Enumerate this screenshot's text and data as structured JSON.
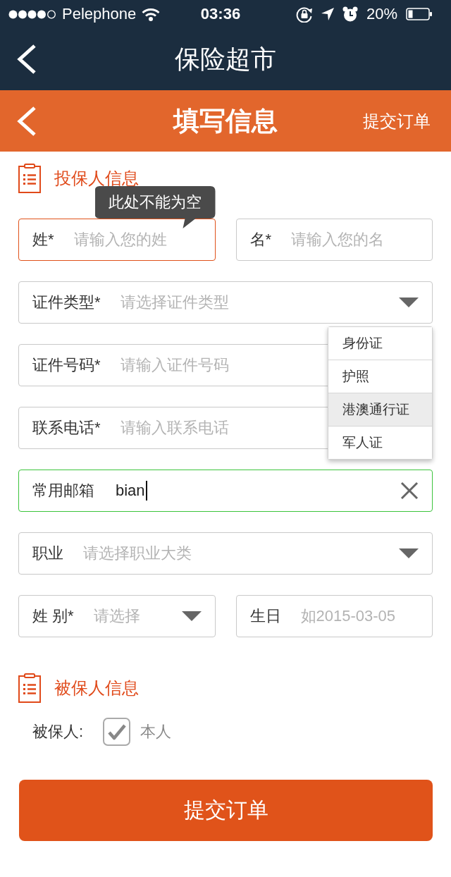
{
  "status_bar": {
    "carrier": "Pelephone",
    "time": "03:36",
    "battery": "20%"
  },
  "nav_bar": {
    "title": "保险超市"
  },
  "header": {
    "title": "填写信息",
    "action": "提交订单"
  },
  "sections": [
    {
      "title": "投保人信息",
      "rows": [
        [
          {
            "kind": "text",
            "label": "姓*",
            "placeholder": "请输入您的姓",
            "error": true,
            "focused": false,
            "tooltip": "此处不能为空"
          },
          {
            "kind": "text",
            "label": "名*",
            "placeholder": "请输入您的名",
            "error": false,
            "focused": false
          }
        ],
        [
          {
            "kind": "select",
            "label": "证件类型*",
            "placeholder": "请选择证件类型",
            "error": false,
            "focused": false
          }
        ],
        [
          {
            "kind": "text",
            "label": "证件号码*",
            "placeholder": "请输入证件号码",
            "error": false,
            "focused": false
          }
        ],
        [
          {
            "kind": "text",
            "label": "联系电话*",
            "placeholder": "请输入联系电话",
            "error": false,
            "focused": false
          }
        ],
        [
          {
            "kind": "text",
            "label": "常用邮箱",
            "value": "bian",
            "error": false,
            "focused": true
          }
        ],
        [
          {
            "kind": "select",
            "label": "职业",
            "placeholder": "请选择职业大类",
            "error": false,
            "focused": false
          }
        ],
        [
          {
            "kind": "select",
            "label": "姓 别*",
            "placeholder": "请选择",
            "error": false,
            "focused": false
          },
          {
            "kind": "text",
            "label": "生日",
            "placeholder": "如2015-03-05",
            "error": false,
            "focused": false
          }
        ]
      ],
      "dropdown_menu": [
        {
          "label": "身份证",
          "selected": false
        },
        {
          "label": "护照",
          "selected": false
        },
        {
          "label": "港澳通行证",
          "selected": true
        },
        {
          "label": "军人证",
          "selected": false
        }
      ]
    },
    {
      "title": "被保人信息",
      "rows": [
        [
          {
            "kind": "checkbox",
            "label": "被保人:",
            "option": "本人",
            "checked": true
          }
        ]
      ]
    }
  ],
  "submit_button": {
    "label": "提交订单"
  }
}
